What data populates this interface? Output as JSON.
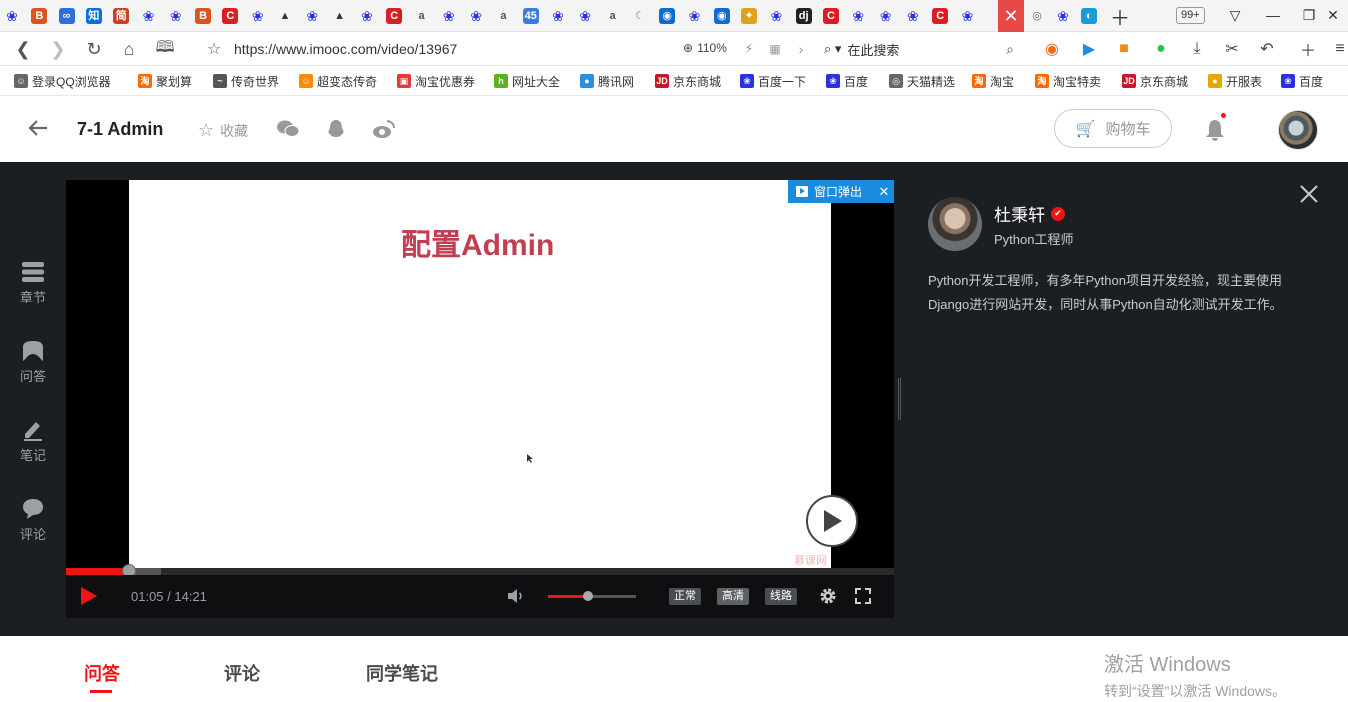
{
  "browser": {
    "tabs_overflow_count": "99+",
    "tab_icons": [
      "baidu-paw",
      "brand-b",
      "link",
      "zhi",
      "jian",
      "baidu-paw",
      "baidu-paw",
      "brand-b",
      "red-c",
      "baidu-paw",
      "tux",
      "baidu-paw",
      "tux",
      "baidu-paw",
      "red-c",
      "a-script",
      "baidu-paw",
      "baidu-paw",
      "a-script",
      "number-45",
      "baidu-paw",
      "baidu-paw",
      "a-script",
      "moon",
      "teamviewer",
      "baidu-paw",
      "teamviewer",
      "colorful",
      "baidu-paw",
      "dj",
      "red-c",
      "baidu-paw",
      "baidu-paw",
      "baidu-paw",
      "red-c",
      "baidu-paw",
      "flame",
      "globe",
      "baidu-paw",
      "edge-drop"
    ],
    "url": "https://www.imooc.com/video/13967",
    "zoom": "110%",
    "search_placeholder": "在此搜索"
  },
  "bookmarks": [
    {
      "label": "登录QQ浏览器",
      "icon": "user-icon",
      "color": "#666666"
    },
    {
      "label": "聚划算",
      "icon": "taobao-icon",
      "color": "#ff6a00"
    },
    {
      "label": "传奇世界",
      "icon": "wave-icon",
      "color": "#555555"
    },
    {
      "label": "超变态传奇",
      "icon": "smile-icon",
      "color": "#ff8a00"
    },
    {
      "label": "淘宝优惠券",
      "icon": "coupon-icon",
      "color": "#e4393c"
    },
    {
      "label": "网址大全",
      "icon": "hao-icon",
      "color": "#5bb319"
    },
    {
      "label": "腾讯网",
      "icon": "tencent-icon",
      "color": "#2a8fde"
    },
    {
      "label": "京东商城",
      "icon": "jd-icon",
      "color": "#c81623"
    },
    {
      "label": "百度一下",
      "icon": "baidu-icon",
      "color": "#2932e1"
    },
    {
      "label": "百度",
      "icon": "baidu-icon",
      "color": "#2932e1"
    },
    {
      "label": "天猫精选",
      "icon": "globe-icon",
      "color": "#666666"
    },
    {
      "label": "淘宝",
      "icon": "taobao-icon",
      "color": "#ff6a00"
    },
    {
      "label": "淘宝特卖",
      "icon": "taobao-icon",
      "color": "#ff6a00"
    },
    {
      "label": "京东商城",
      "icon": "jd-icon",
      "color": "#c81623"
    },
    {
      "label": "开服表",
      "icon": "coin-icon",
      "color": "#e0a800"
    },
    {
      "label": "百度",
      "icon": "baidu-icon",
      "color": "#2932e1"
    }
  ],
  "header": {
    "title": "7-1 Admin",
    "favorite_label": "收藏",
    "cart_label": "购物车"
  },
  "sidenav": [
    {
      "label": "章节",
      "icon": "chapters-icon"
    },
    {
      "label": "问答",
      "icon": "qa-icon"
    },
    {
      "label": "笔记",
      "icon": "note-icon"
    },
    {
      "label": "评论",
      "icon": "comment-icon"
    }
  ],
  "player": {
    "slide_title": "配置Admin",
    "watermark": "慕课网",
    "popout_label": "窗口弹出",
    "current_time": "01:05",
    "duration": "14:21",
    "time_display": "01:05 / 14:21",
    "progress_fraction": 0.0755,
    "buffer_fraction": 0.115,
    "volume_fraction": 0.46,
    "quality_options": [
      "正常",
      "高清",
      "线路"
    ],
    "quality_selected": "高清"
  },
  "teacher": {
    "name": "杜秉轩",
    "role": "Python工程师",
    "description": "Python开发工程师，有多年Python项目开发经验，现主要使用Django进行网站开发，同时从事Python自动化测试开发工作。"
  },
  "bottom_tabs": [
    {
      "label": "问答",
      "active": true
    },
    {
      "label": "评论",
      "active": false
    },
    {
      "label": "同学笔记",
      "active": false
    }
  ],
  "windows_activation": {
    "line1": "激活 Windows",
    "line2": "转到“设置”以激活 Windows。"
  },
  "colors": {
    "accent": "#f01414",
    "dark_bg": "#1c1f21",
    "popout_blue": "#1a8ce0",
    "slide_title": "#c23f52"
  }
}
